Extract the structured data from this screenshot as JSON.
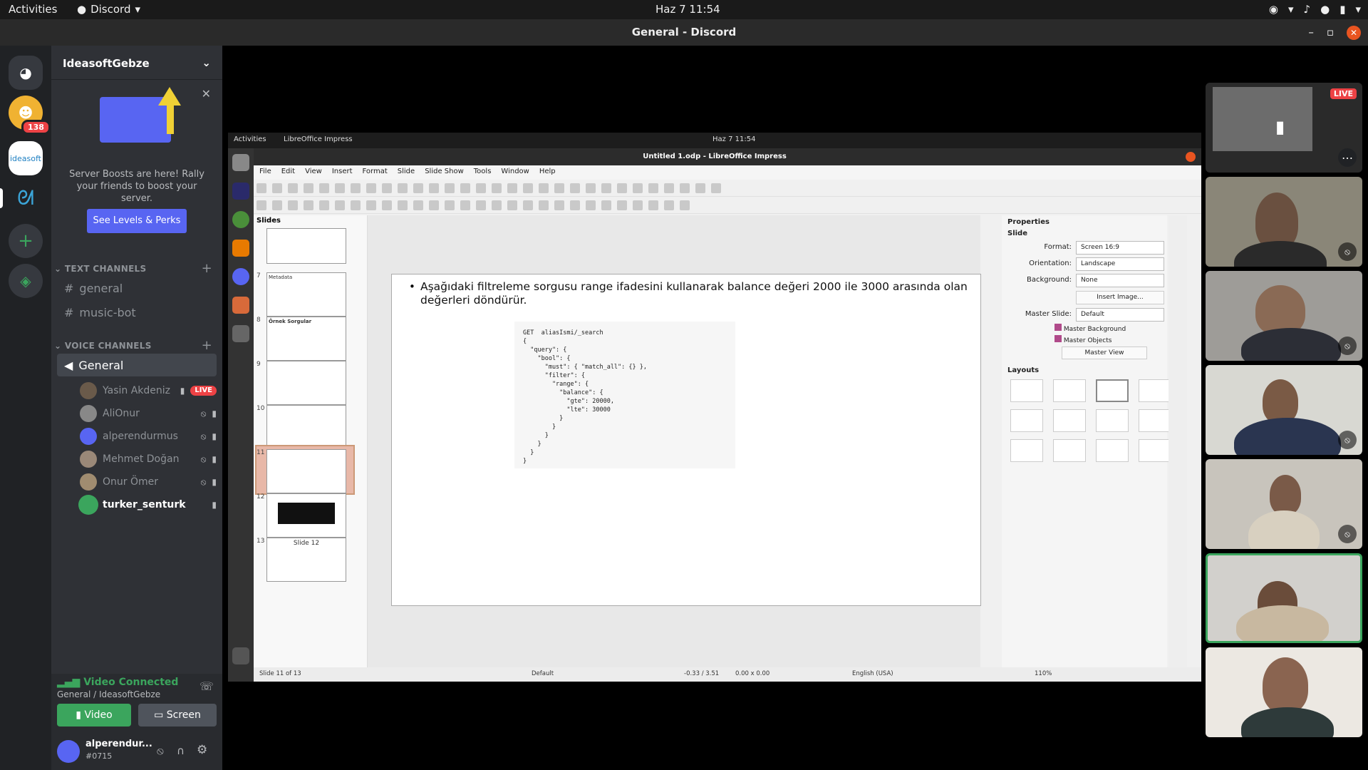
{
  "system_bar": {
    "activities": "Activities",
    "app_name": "Discord",
    "clock": "Haz 7  11:54"
  },
  "window": {
    "title": "General - Discord"
  },
  "server": {
    "name": "IdeasoftGebze",
    "rail_badge": "138"
  },
  "boost": {
    "text": "Server Boosts are here! Rally your friends to boost your server.",
    "button": "See Levels & Perks"
  },
  "channels": {
    "text_header": "TEXT CHANNELS",
    "text": [
      "general",
      "music-bot"
    ],
    "voice_header": "VOICE CHANNELS",
    "voice": "General",
    "users": [
      {
        "name": "Yasin Akdeniz",
        "live": "LIVE"
      },
      {
        "name": "AliOnur"
      },
      {
        "name": "alperendurmus"
      },
      {
        "name": "Mehmet Doğan"
      },
      {
        "name": "Onur Ömer"
      },
      {
        "name": "turker_senturk"
      }
    ]
  },
  "voice_connection": {
    "status": "Video Connected",
    "location": "General / IdeasoftGebze",
    "video_button": "Video",
    "screen_button": "Screen"
  },
  "user_panel": {
    "name": "alperendur...",
    "tag": "#0715"
  },
  "shared_screen": {
    "activities": "Activities",
    "app": "LibreOffice Impress",
    "clock": "Haz 7  11:54",
    "title": "Untitled 1.odp - LibreOffice Impress",
    "menu": [
      "File",
      "Edit",
      "View",
      "Insert",
      "Format",
      "Slide",
      "Slide Show",
      "Tools",
      "Window",
      "Help"
    ],
    "slides_title": "Slides",
    "slide_numbers": [
      "7",
      "8",
      "9",
      "10",
      "11",
      "12",
      "13"
    ],
    "thumb_8_title": "Örnek Sorgular",
    "thumb_7_title": "Metadata",
    "thumb_13_title": "Slide 12",
    "bullet": "Aşağıdaki filtreleme sorgusu range ifadesini kullanarak balance değeri 2000 ile 3000 arasında olan değerleri döndürür.",
    "code": "GET  aliasIsmi/_search\n{\n  \"query\": {\n    \"bool\": {\n      \"must\": { \"match_all\": {} },\n      \"filter\": {\n        \"range\": {\n          \"balance\": {\n            \"gte\": 20000,\n            \"lte\": 30000\n          }\n        }\n      }\n    }\n  }\n}",
    "properties_title": "Properties",
    "slide_section": "Slide",
    "format_label": "Format:",
    "format_value": "Screen 16:9",
    "orientation_label": "Orientation:",
    "orientation_value": "Landscape",
    "background_label": "Background:",
    "background_value": "None",
    "insert_image": "Insert Image...",
    "master_slide_label": "Master Slide:",
    "master_slide_value": "Default",
    "master_background": "Master Background",
    "master_objects": "Master Objects",
    "master_view": "Master View",
    "layouts_section": "Layouts",
    "status_slide": "Slide 11 of 13",
    "status_master": "Default",
    "status_pos": "-0.33 / 3.51",
    "status_size": "0.00 x 0.00",
    "status_lang": "English (USA)",
    "status_zoom": "110%"
  },
  "video_tiles": {
    "live": "LIVE"
  }
}
